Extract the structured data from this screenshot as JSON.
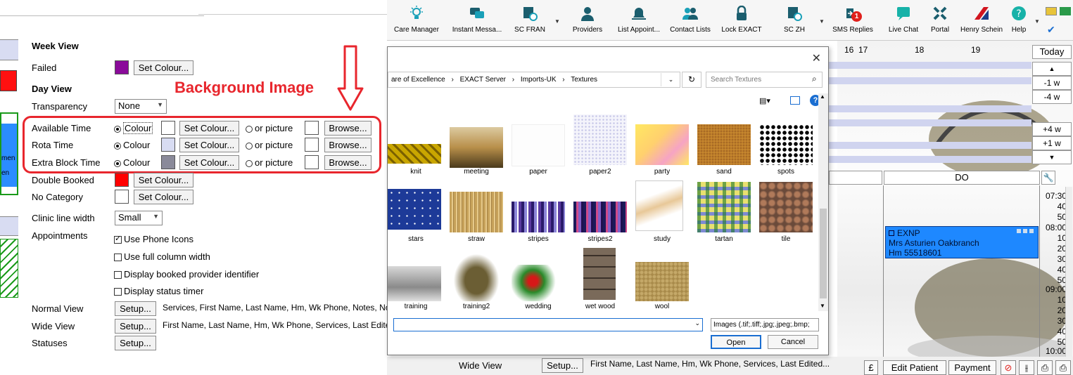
{
  "settings": {
    "week_view_header": "Week View",
    "failed_label": "Failed",
    "failed_color": "#8a0b9a",
    "set_colour_label": "Set Colour...",
    "day_view_header": "Day View",
    "transparency_label": "Transparency",
    "transparency_value": "None",
    "rows": [
      {
        "label": "Available Time",
        "colour_label": "Colour",
        "swatch": "#ffffff",
        "picture_label": "or picture",
        "browse_label": "Browse..."
      },
      {
        "label": "Rota Time",
        "colour_label": "Colour",
        "swatch": "#d8dcf2",
        "picture_label": "or picture",
        "browse_label": "Browse..."
      },
      {
        "label": "Extra Block Time",
        "colour_label": "Colour",
        "swatch": "#8a8a9a",
        "picture_label": "or picture",
        "browse_label": "Browse..."
      }
    ],
    "double_booked_label": "Double Booked",
    "double_booked_color": "#ff0000",
    "no_category_label": "No Category",
    "no_category_color": "#ffffff",
    "clinic_line_width_label": "Clinic line width",
    "clinic_line_width_value": "Small",
    "appointments_label": "Appointments",
    "checks": [
      {
        "label": "Use Phone Icons",
        "checked": true
      },
      {
        "label": "Use full column width",
        "checked": false
      },
      {
        "label": "Display booked provider identifier",
        "checked": false
      },
      {
        "label": "Display status timer",
        "checked": false
      }
    ],
    "normal_view_label": "Normal View",
    "normal_view_text": "Services, First Name, Last Name, Hm, Wk Phone, Notes, Not...",
    "wide_view_label": "Wide View",
    "wide_view_text": "First Name, Last Name, Hm, Wk Phone, Services, Last Edited...",
    "statuses_label": "Statuses",
    "setup_label": "Setup...",
    "edge_text_1": "men",
    "edge_text_2": "en"
  },
  "annotation": {
    "text": "Background Image"
  },
  "toolbar": {
    "items": [
      {
        "label": "Care Manager"
      },
      {
        "label": "Instant Messa..."
      },
      {
        "label": "SC FRAN"
      },
      {
        "label": "Providers"
      },
      {
        "label": "List Appoint..."
      },
      {
        "label": "Contact Lists"
      },
      {
        "label": "Lock EXACT"
      },
      {
        "label": "SC ZH"
      },
      {
        "label": "SMS Replies"
      },
      {
        "label": "Live Chat"
      },
      {
        "label": "Portal"
      },
      {
        "label": "Henry Schein"
      },
      {
        "label": "Help"
      }
    ],
    "sms_badge": "1"
  },
  "calendar": {
    "day_numbers": [
      "16",
      "17",
      "18",
      "19"
    ],
    "nav": [
      "Today",
      "-1 w",
      "-4 w",
      "+4 w",
      "+1 w"
    ],
    "column_header": "DO",
    "times": [
      "07:30",
      "40",
      "50",
      "08:00",
      "10",
      "20",
      "30",
      "40",
      "50",
      "09:00",
      "10",
      "20",
      "30",
      "40",
      "50",
      "10:00"
    ],
    "appointment": {
      "code": "EXNP",
      "name": "Mrs Asturien Oakbranch",
      "phone": "Hm 55518601"
    }
  },
  "bottom": {
    "wide_view_label": "Wide View",
    "setup_label": "Setup...",
    "wide_view_text": "First Name, Last Name, Hm, Wk Phone, Services, Last Edited...",
    "pound": "£",
    "edit_patient": "Edit Patient",
    "payment": "Payment"
  },
  "dialog": {
    "breadcrumb": [
      "are of Excellence",
      "EXACT Server",
      "Imports-UK",
      "Textures"
    ],
    "search_placeholder": "Search Textures",
    "textures": [
      "knit",
      "meeting",
      "paper",
      "paper2",
      "party",
      "sand",
      "spots",
      "stars",
      "straw",
      "stripes",
      "stripes2",
      "study",
      "tartan",
      "tile",
      "training",
      "training2",
      "wedding",
      "wet wood",
      "wool"
    ],
    "filetype": "Images (.tif;.tiff;.jpg;.jpeg;.bmp;",
    "open_label": "Open",
    "cancel_label": "Cancel"
  }
}
